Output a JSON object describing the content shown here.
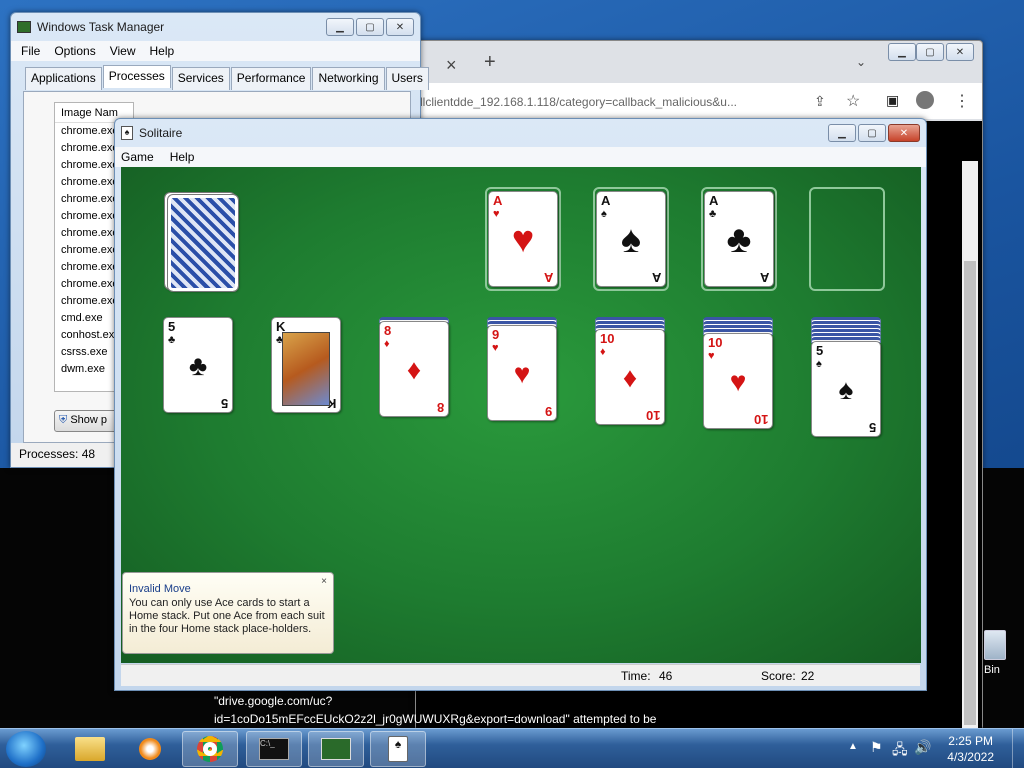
{
  "task_manager": {
    "title": "Windows Task Manager",
    "menu": [
      "File",
      "Options",
      "View",
      "Help"
    ],
    "tabs": [
      "Applications",
      "Processes",
      "Services",
      "Performance",
      "Networking",
      "Users"
    ],
    "active_tab": "Processes",
    "column_header": "Image Nam",
    "processes": [
      "chrome.exe",
      "chrome.exe",
      "chrome.exe",
      "chrome.exe",
      "chrome.exe",
      "chrome.exe",
      "chrome.exe",
      "chrome.exe",
      "chrome.exe",
      "chrome.exe",
      "chrome.exe",
      "cmd.exe",
      "conhost.exe",
      "csrss.exe",
      "dwm.exe"
    ],
    "show_button": "Show p",
    "status": "Processes: 48"
  },
  "chrome": {
    "close_tab": "×",
    "new_tab": "+",
    "address": "...categor...",
    "address_full": "llclientdde_192.168.1.118/category=callback_malicious&u..."
  },
  "solitaire": {
    "title": "Solitaire",
    "menu": [
      "Game",
      "Help"
    ],
    "foundations": [
      {
        "rank": "A",
        "suit": "♥",
        "color": "red"
      },
      {
        "rank": "A",
        "suit": "♠",
        "color": "blk"
      },
      {
        "rank": "A",
        "suit": "♣",
        "color": "blk"
      }
    ],
    "tableau": [
      {
        "rank": "5",
        "suit": "♣",
        "color": "blk"
      },
      {
        "rank": "K",
        "suit": "♣",
        "color": "blk"
      },
      {
        "rank": "8",
        "suit": "♦",
        "color": "red"
      },
      {
        "rank": "9",
        "suit": "♥",
        "color": "red"
      },
      {
        "rank": "10",
        "suit": "♦",
        "color": "red"
      },
      {
        "rank": "10",
        "suit": "♥",
        "color": "red"
      },
      {
        "rank": "5",
        "suit": "♠",
        "color": "blk"
      }
    ],
    "time_label": "Time:",
    "time_value": "46",
    "score_label": "Score:",
    "score_value": "22"
  },
  "toast": {
    "title": "Invalid Move",
    "body": "You can only use Ace cards to start a Home stack. Put one Ace from each suit in the four Home stack place-holders.",
    "close": "×"
  },
  "download_notice": {
    "line1": "\"drive.google.com/uc?",
    "line2": "id=1coDo15mEFccEUckO2z2l_jr0gWUWUXRg&export=download\" attempted to be"
  },
  "taskbar": {
    "time": "2:25 PM",
    "date": "4/3/2022"
  },
  "desktop": {
    "recycle_label": "Bin"
  }
}
